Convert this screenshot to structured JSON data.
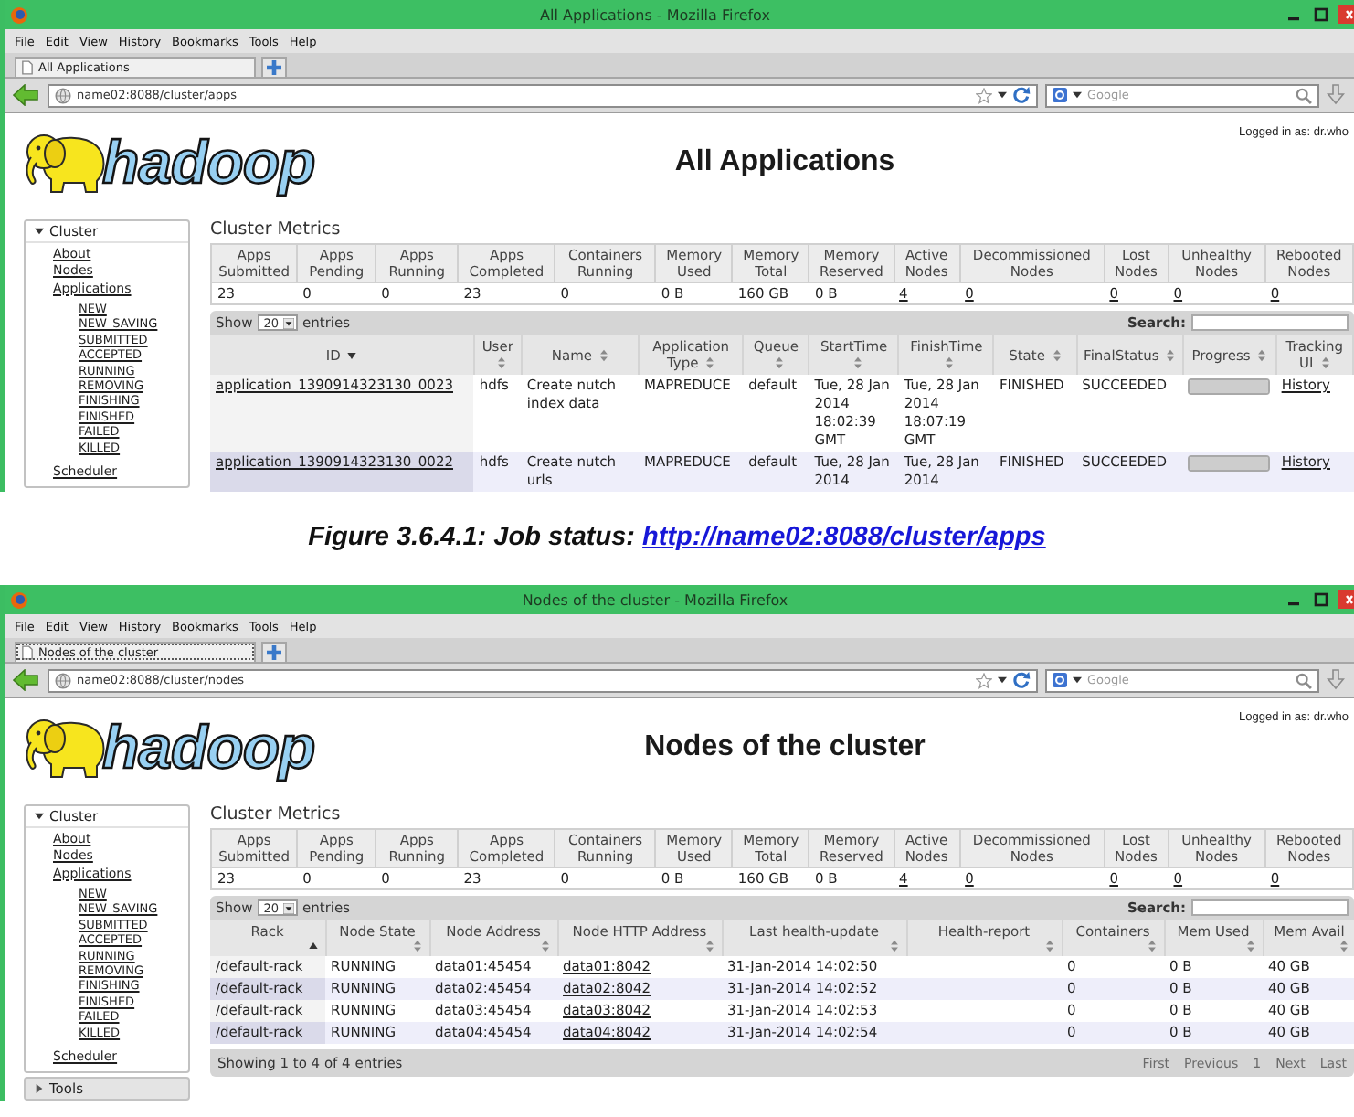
{
  "figures": [
    {
      "window": {
        "title": "All Applications - Mozilla Firefox",
        "menu": [
          "File",
          "Edit",
          "View",
          "History",
          "Bookmarks",
          "Tools",
          "Help"
        ],
        "tabs": [
          {
            "label": "All Applications",
            "selected": true
          }
        ],
        "address": {
          "value": "name02:8088/cluster/apps"
        },
        "search": {
          "placeholder": "Google"
        },
        "page": {
          "logo_text": "hadoop",
          "heading": "All Applications",
          "login": "Logged in as: dr.who",
          "sidebar": [
            {
              "label": "Cluster",
              "expanded": true,
              "items": [
                {
                  "label": "About"
                },
                {
                  "label": "Nodes"
                },
                {
                  "label": "Applications",
                  "children": [
                    {
                      "label": "NEW"
                    },
                    {
                      "label": "NEW_SAVING"
                    },
                    {
                      "label": "SUBMITTED"
                    },
                    {
                      "label": "ACCEPTED"
                    },
                    {
                      "label": "RUNNING"
                    },
                    {
                      "label": "REMOVING"
                    },
                    {
                      "label": "FINISHING"
                    },
                    {
                      "label": "FINISHED"
                    },
                    {
                      "label": "FAILED"
                    },
                    {
                      "label": "KILLED"
                    }
                  ]
                },
                {
                  "label": "Scheduler"
                }
              ]
            }
          ],
          "metrics": {
            "title": "Cluster Metrics",
            "columns": [
              "Apps Submitted",
              "Apps Pending",
              "Apps Running",
              "Apps Completed",
              "Containers Running",
              "Memory Used",
              "Memory Total",
              "Memory Reserved",
              "Active Nodes",
              "Decommissioned Nodes",
              "Lost Nodes",
              "Unhealthy Nodes",
              "Rebooted Nodes"
            ],
            "values": [
              {
                "kind": "text",
                "text": "23"
              },
              {
                "kind": "text",
                "text": "0"
              },
              {
                "kind": "text",
                "text": "0"
              },
              {
                "kind": "text",
                "text": "23"
              },
              {
                "kind": "text",
                "text": "0"
              },
              {
                "kind": "text",
                "text": "0 B"
              },
              {
                "kind": "text",
                "text": "160 GB"
              },
              {
                "kind": "text",
                "text": "0 B"
              },
              {
                "kind": "link",
                "text": "4"
              },
              {
                "kind": "link",
                "text": "0"
              },
              {
                "kind": "link",
                "text": "0"
              },
              {
                "kind": "link",
                "text": "0"
              },
              {
                "kind": "link",
                "text": "0"
              }
            ]
          },
          "table": {
            "show_label": "Show",
            "page_size": "20",
            "entries_label": "entries",
            "search_label": "Search:",
            "columns": [
              {
                "label": "ID",
                "kind": "descending"
              },
              {
                "label": "User",
                "kind": "sortable"
              },
              {
                "label": "Name",
                "kind": "sortable"
              },
              {
                "label": "Application Type",
                "kind": "sortable"
              },
              {
                "label": "Queue",
                "kind": "sortable"
              },
              {
                "label": "StartTime",
                "kind": "sortable"
              },
              {
                "label": "FinishTime",
                "kind": "sortable"
              },
              {
                "label": "State",
                "kind": "sortable"
              },
              {
                "label": "FinalStatus",
                "kind": "sortable"
              },
              {
                "label": "Progress",
                "kind": "sortable"
              },
              {
                "label": "Tracking UI",
                "kind": "sortable"
              }
            ],
            "rows": [
              {
                "cells": [
                  {
                    "kind": "link",
                    "text": "application_1390914323130_0023"
                  },
                  {
                    "kind": "text",
                    "text": "hdfs"
                  },
                  {
                    "kind": "text",
                    "text": "Create nutch index data"
                  },
                  {
                    "kind": "text",
                    "text": "MAPREDUCE"
                  },
                  {
                    "kind": "text",
                    "text": "default"
                  },
                  {
                    "kind": "text",
                    "text": "Tue, 28 Jan 2014 18:02:39 GMT"
                  },
                  {
                    "kind": "text",
                    "text": "Tue, 28 Jan 2014 18:07:19 GMT"
                  },
                  {
                    "kind": "text",
                    "text": "FINISHED"
                  },
                  {
                    "kind": "text",
                    "text": "SUCCEEDED"
                  },
                  {
                    "kind": "progress",
                    "level": 1
                  },
                  {
                    "kind": "link",
                    "text": "History"
                  }
                ]
              },
              {
                "cells": [
                  {
                    "kind": "link",
                    "text": "application_1390914323130_0022"
                  },
                  {
                    "kind": "text",
                    "text": "hdfs"
                  },
                  {
                    "kind": "text",
                    "text": "Create nutch urls"
                  },
                  {
                    "kind": "text",
                    "text": "MAPREDUCE"
                  },
                  {
                    "kind": "text",
                    "text": "default"
                  },
                  {
                    "kind": "text",
                    "text": "Tue, 28 Jan 2014"
                  },
                  {
                    "kind": "text",
                    "text": "Tue, 28 Jan 2014"
                  },
                  {
                    "kind": "text",
                    "text": "FINISHED"
                  },
                  {
                    "kind": "text",
                    "text": "SUCCEEDED"
                  },
                  {
                    "kind": "progress",
                    "level": 1
                  },
                  {
                    "kind": "link",
                    "text": "History"
                  }
                ]
              }
            ]
          }
        }
      },
      "caption": {
        "text": "Figure 3.6.4.1: Job status:",
        "link": "http://name02:8088/cluster/apps"
      }
    },
    {
      "window": {
        "title": "Nodes of the cluster - Mozilla Firefox",
        "menu": [
          "File",
          "Edit",
          "View",
          "History",
          "Bookmarks",
          "Tools",
          "Help"
        ],
        "tabs": [
          {
            "label": "Nodes of the cluster",
            "selected": true
          }
        ],
        "address": {
          "value": "name02:8088/cluster/nodes"
        },
        "search": {
          "placeholder": "Google"
        },
        "page": {
          "logo_text": "hadoop",
          "heading": "Nodes of the cluster",
          "login": "Logged in as: dr.who",
          "sidebar": [
            {
              "label": "Cluster",
              "expanded": true,
              "items": [
                {
                  "label": "About"
                },
                {
                  "label": "Nodes"
                },
                {
                  "label": "Applications",
                  "children": [
                    {
                      "label": "NEW"
                    },
                    {
                      "label": "NEW_SAVING"
                    },
                    {
                      "label": "SUBMITTED"
                    },
                    {
                      "label": "ACCEPTED"
                    },
                    {
                      "label": "RUNNING"
                    },
                    {
                      "label": "REMOVING"
                    },
                    {
                      "label": "FINISHING"
                    },
                    {
                      "label": "FINISHED"
                    },
                    {
                      "label": "FAILED"
                    },
                    {
                      "label": "KILLED"
                    }
                  ]
                },
                {
                  "label": "Scheduler"
                }
              ]
            },
            {
              "label": "Tools",
              "expanded": false
            }
          ],
          "metrics": {
            "title": "Cluster Metrics",
            "columns": [
              "Apps Submitted",
              "Apps Pending",
              "Apps Running",
              "Apps Completed",
              "Containers Running",
              "Memory Used",
              "Memory Total",
              "Memory Reserved",
              "Active Nodes",
              "Decommissioned Nodes",
              "Lost Nodes",
              "Unhealthy Nodes",
              "Rebooted Nodes"
            ],
            "values": [
              {
                "kind": "text",
                "text": "23"
              },
              {
                "kind": "text",
                "text": "0"
              },
              {
                "kind": "text",
                "text": "0"
              },
              {
                "kind": "text",
                "text": "23"
              },
              {
                "kind": "text",
                "text": "0"
              },
              {
                "kind": "text",
                "text": "0 B"
              },
              {
                "kind": "text",
                "text": "160 GB"
              },
              {
                "kind": "text",
                "text": "0 B"
              },
              {
                "kind": "link",
                "text": "4"
              },
              {
                "kind": "link",
                "text": "0"
              },
              {
                "kind": "link",
                "text": "0"
              },
              {
                "kind": "link",
                "text": "0"
              },
              {
                "kind": "link",
                "text": "0"
              }
            ]
          },
          "table": {
            "show_label": "Show",
            "page_size": "20",
            "entries_label": "entries",
            "search_label": "Search:",
            "columns": [
              {
                "label": "Rack",
                "kind": "ascending"
              },
              {
                "label": "Node State",
                "kind": "sortable"
              },
              {
                "label": "Node Address",
                "kind": "sortable"
              },
              {
                "label": "Node HTTP Address",
                "kind": "sortable"
              },
              {
                "label": "Last health-update",
                "kind": "sortable"
              },
              {
                "label": "Health-report",
                "kind": "sortable"
              },
              {
                "label": "Containers",
                "kind": "sortable"
              },
              {
                "label": "Mem Used",
                "kind": "sortable"
              },
              {
                "label": "Mem Avail",
                "kind": "sortable"
              }
            ],
            "rows": [
              {
                "cells": [
                  {
                    "kind": "text",
                    "text": "/default-rack"
                  },
                  {
                    "kind": "text",
                    "text": "RUNNING"
                  },
                  {
                    "kind": "text",
                    "text": "data01:45454"
                  },
                  {
                    "kind": "link",
                    "text": "data01:8042"
                  },
                  {
                    "kind": "text",
                    "text": "31-Jan-2014 14:02:50"
                  },
                  {
                    "kind": "blank"
                  },
                  {
                    "kind": "text",
                    "text": "0"
                  },
                  {
                    "kind": "text",
                    "text": "0 B"
                  },
                  {
                    "kind": "text",
                    "text": "40 GB"
                  }
                ]
              },
              {
                "cells": [
                  {
                    "kind": "text",
                    "text": "/default-rack"
                  },
                  {
                    "kind": "text",
                    "text": "RUNNING"
                  },
                  {
                    "kind": "text",
                    "text": "data02:45454"
                  },
                  {
                    "kind": "link",
                    "text": "data02:8042"
                  },
                  {
                    "kind": "text",
                    "text": "31-Jan-2014 14:02:52"
                  },
                  {
                    "kind": "blank"
                  },
                  {
                    "kind": "text",
                    "text": "0"
                  },
                  {
                    "kind": "text",
                    "text": "0 B"
                  },
                  {
                    "kind": "text",
                    "text": "40 GB"
                  }
                ]
              },
              {
                "cells": [
                  {
                    "kind": "text",
                    "text": "/default-rack"
                  },
                  {
                    "kind": "text",
                    "text": "RUNNING"
                  },
                  {
                    "kind": "text",
                    "text": "data03:45454"
                  },
                  {
                    "kind": "link",
                    "text": "data03:8042"
                  },
                  {
                    "kind": "text",
                    "text": "31-Jan-2014 14:02:53"
                  },
                  {
                    "kind": "blank"
                  },
                  {
                    "kind": "text",
                    "text": "0"
                  },
                  {
                    "kind": "text",
                    "text": "0 B"
                  },
                  {
                    "kind": "text",
                    "text": "40 GB"
                  }
                ]
              },
              {
                "cells": [
                  {
                    "kind": "text",
                    "text": "/default-rack"
                  },
                  {
                    "kind": "text",
                    "text": "RUNNING"
                  },
                  {
                    "kind": "text",
                    "text": "data04:45454"
                  },
                  {
                    "kind": "link",
                    "text": "data04:8042"
                  },
                  {
                    "kind": "text",
                    "text": "31-Jan-2014 14:02:54"
                  },
                  {
                    "kind": "blank"
                  },
                  {
                    "kind": "text",
                    "text": "0"
                  },
                  {
                    "kind": "text",
                    "text": "0 B"
                  },
                  {
                    "kind": "text",
                    "text": "40 GB"
                  }
                ]
              }
            ],
            "footer": {
              "info": "Showing 1 to 4 of 4 entries",
              "pages": [
                {
                  "label": "First",
                  "disabled": true
                },
                {
                  "label": "Previous",
                  "disabled": true
                },
                {
                  "label": "1",
                  "disabled": true
                },
                {
                  "label": "Next",
                  "disabled": true
                },
                {
                  "label": "Last",
                  "disabled": true
                }
              ]
            }
          }
        }
      }
    }
  ]
}
